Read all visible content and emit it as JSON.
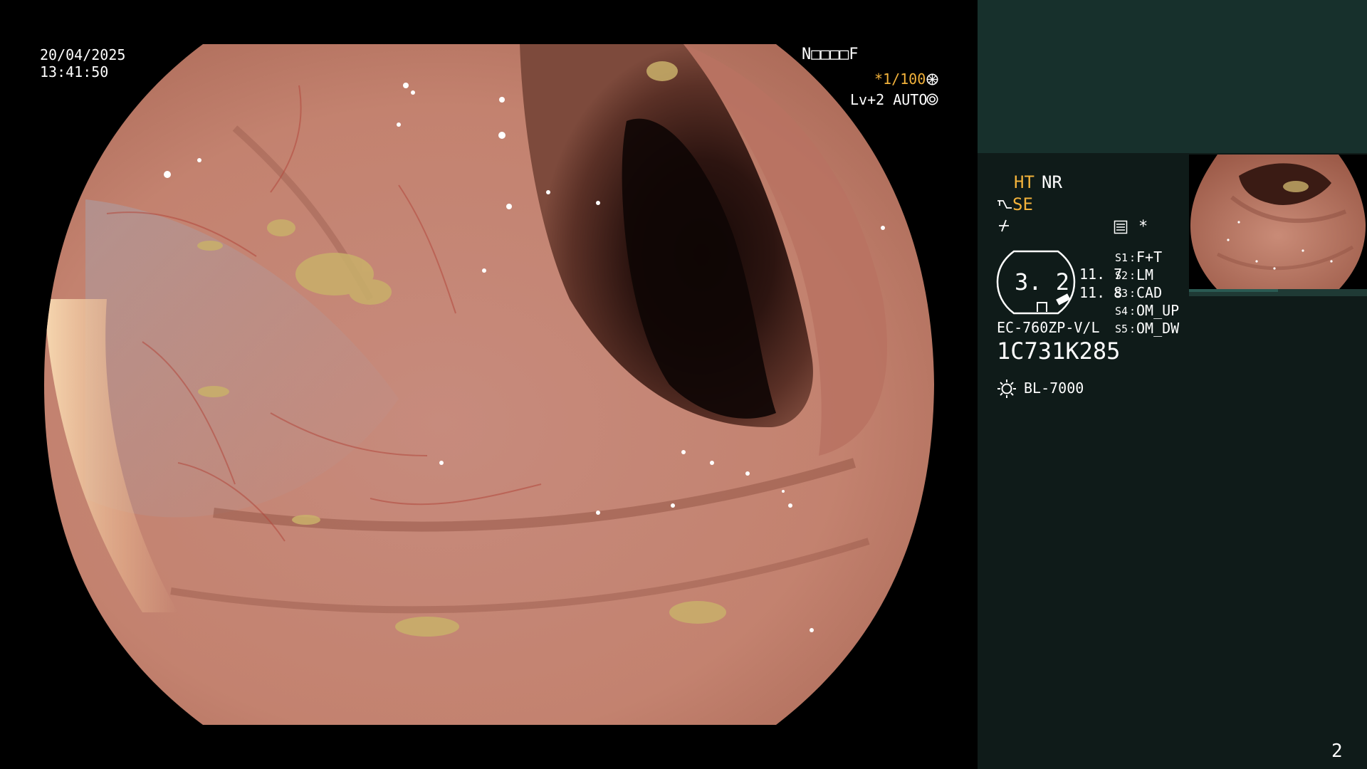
{
  "overlay": {
    "date": "20/04/2025",
    "time": "13:41:50",
    "patient_code": "N□□□□F",
    "shutter": "*1/100",
    "shutter_icon": "aperture-icon",
    "level": "Lv+2 AUTO",
    "level_icon": "iris-icon"
  },
  "panel": {
    "mode_ht": "HT",
    "mode_nr": "NR",
    "mode_se": "SE",
    "se_icon": "scope-tip-icon",
    "freeze_icon": "freeze-icon",
    "menu_icon": "settings-list-icon",
    "asterisk": "*",
    "gauge_value": "3. 2",
    "gauge_side_top": "11. 7",
    "gauge_side_bottom": "11. 8",
    "scope_model": "EC-760ZP-V/L",
    "serial": "1C731K285",
    "light_source": "BL-7000",
    "light_icon": "light-source-icon",
    "presets": [
      {
        "key": "S1",
        "value": "F+T"
      },
      {
        "key": "S2",
        "value": "LM"
      },
      {
        "key": "S3",
        "value": "CAD"
      },
      {
        "key": "S4",
        "value": "OM_UP"
      },
      {
        "key": "S5",
        "value": "OM_DW"
      }
    ],
    "page_number": "2"
  },
  "colors": {
    "panel_bg": "#0f1b19",
    "panel_top_bg": "#17302c",
    "accent": "#f2b23b",
    "mucosa": "#c98a78"
  }
}
